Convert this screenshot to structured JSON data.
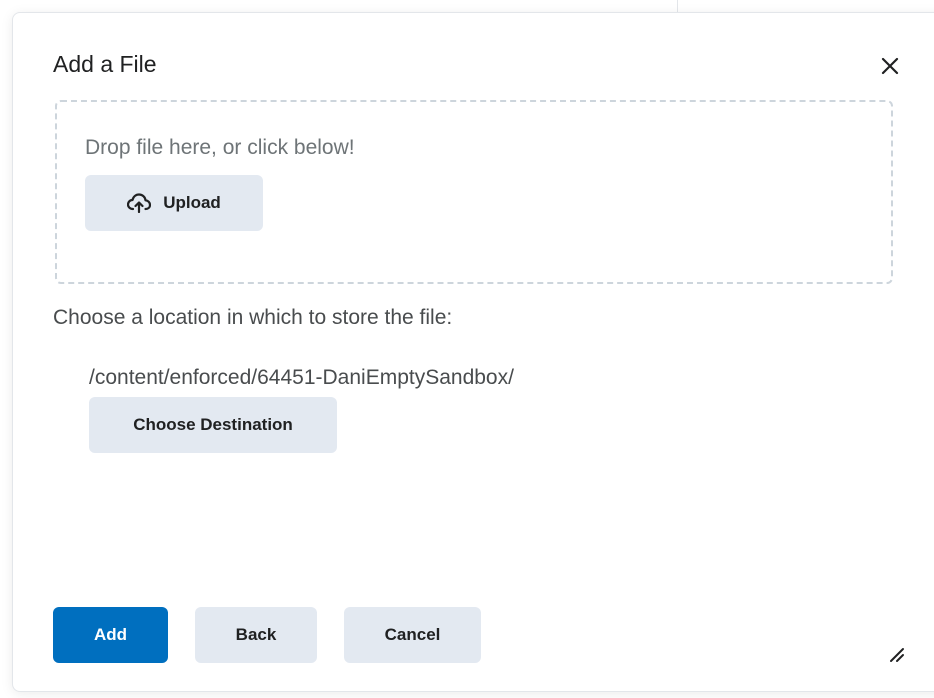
{
  "dialog": {
    "title": "Add a File",
    "close_icon": "close-icon"
  },
  "dropzone": {
    "text": "Drop file here, or click below!",
    "upload_label": "Upload",
    "upload_icon": "upload-cloud-icon"
  },
  "location": {
    "label": "Choose a location in which to store the file:",
    "path": "/content/enforced/64451-DaniEmptySandbox/",
    "choose_label": "Choose Destination"
  },
  "footer": {
    "add_label": "Add",
    "back_label": "Back",
    "cancel_label": "Cancel",
    "resize_icon": "resize-handle-icon"
  },
  "colors": {
    "primary": "#006fbf",
    "secondary_button": "#e3e9f1",
    "dashed_border": "#cdd5dc",
    "text": "#202122"
  }
}
